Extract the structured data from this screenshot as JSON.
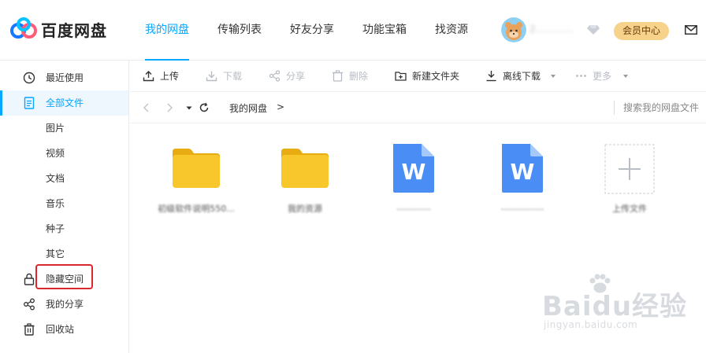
{
  "header": {
    "brand": "百度网盘",
    "nav": [
      "我的网盘",
      "传输列表",
      "好友分享",
      "功能宝箱",
      "找资源"
    ],
    "active_nav": "我的网盘",
    "username": "2…………",
    "vip_label": "会员中心"
  },
  "sidebar": {
    "items": [
      {
        "label": "最近使用",
        "icon": "clock-icon"
      },
      {
        "label": "全部文件",
        "icon": "document-icon",
        "active": true
      },
      {
        "label": "图片"
      },
      {
        "label": "视频"
      },
      {
        "label": "文档"
      },
      {
        "label": "音乐"
      },
      {
        "label": "种子"
      },
      {
        "label": "其它"
      },
      {
        "label": "隐藏空间",
        "icon": "lock-icon"
      },
      {
        "label": "我的分享",
        "icon": "share-icon"
      },
      {
        "label": "回收站",
        "icon": "trash-icon"
      }
    ]
  },
  "toolbar": {
    "upload": "上传",
    "download": "下载",
    "share": "分享",
    "delete": "删除",
    "new_folder": "新建文件夹",
    "offline_download": "离线下载",
    "more": "更多"
  },
  "breadcrumb": {
    "current": "我的网盘",
    "separator": ">",
    "search_placeholder": "搜索我的网盘文件"
  },
  "files": [
    {
      "type": "folder",
      "name": "初级软件说明550..."
    },
    {
      "type": "folder",
      "name": "我的资源"
    },
    {
      "type": "word",
      "name": "…………"
    },
    {
      "type": "word",
      "name": "……………"
    },
    {
      "type": "add",
      "name": "上传文件"
    }
  ],
  "watermark": {
    "brand": "Baidu经验",
    "url": "jingyan.baidu.com"
  },
  "colors": {
    "accent": "#06a7ff",
    "folder": "#f7c72b",
    "word": "#4a8ef5",
    "vip": "#f6d28a",
    "highlight_box": "#d9272e"
  }
}
